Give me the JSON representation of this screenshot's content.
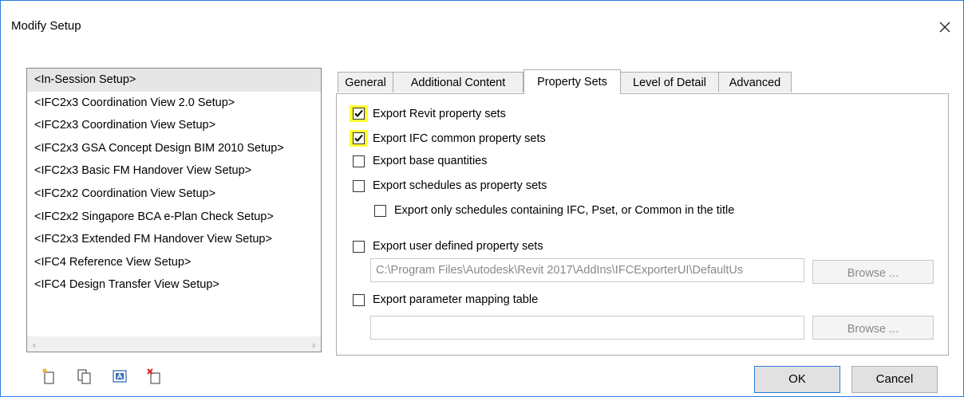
{
  "window": {
    "title": "Modify Setup"
  },
  "setups": [
    "<In-Session Setup>",
    "<IFC2x3 Coordination View 2.0 Setup>",
    "<IFC2x3 Coordination View Setup>",
    "<IFC2x3 GSA Concept Design BIM 2010 Setup>",
    "<IFC2x3 Basic FM Handover View Setup>",
    "<IFC2x2 Coordination View Setup>",
    "<IFC2x2 Singapore BCA e-Plan Check Setup>",
    "<IFC2x3 Extended FM Handover View Setup>",
    "<IFC4 Reference View Setup>",
    "<IFC4 Design Transfer View Setup>"
  ],
  "tabs": [
    "General",
    "Additional Content",
    "Property Sets",
    "Level of Detail",
    "Advanced"
  ],
  "active_tab": "Property Sets",
  "options": {
    "revit_psets": {
      "label": "Export Revit property sets",
      "checked": true
    },
    "ifc_common_psets": {
      "label": "Export IFC common property sets",
      "checked": true
    },
    "base_quantities": {
      "label": "Export base quantities",
      "checked": false
    },
    "schedules": {
      "label": "Export schedules as property sets",
      "checked": false
    },
    "schedules_only": {
      "label": "Export only schedules containing IFC, Pset, or Common in the title",
      "checked": false
    },
    "user_defined": {
      "label": "Export user defined property sets",
      "checked": false
    },
    "user_defined_path": "C:\\Program Files\\Autodesk\\Revit 2017\\AddIns\\IFCExporterUI\\DefaultUs",
    "param_mapping": {
      "label": "Export parameter mapping table",
      "checked": false
    },
    "param_mapping_path": ""
  },
  "buttons": {
    "browse": "Browse ...",
    "ok": "OK",
    "cancel": "Cancel"
  },
  "icons": [
    "new-setup-icon",
    "duplicate-setup-icon",
    "rename-setup-icon",
    "delete-setup-icon"
  ],
  "colors": {
    "highlight": "#ffff33",
    "accent": "#2b79d8"
  }
}
